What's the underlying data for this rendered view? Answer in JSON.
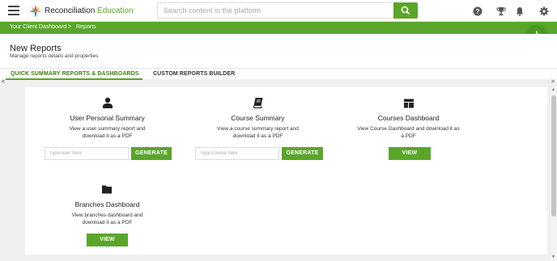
{
  "header": {
    "logo_text": "Reconciliation",
    "logo_accent": "Education",
    "search_placeholder": "Search content in the platform"
  },
  "breadcrumb": {
    "home": "Your Client Dashboard",
    "separator": ">",
    "current": "Reports"
  },
  "fab_label": "+",
  "page": {
    "title": "New Reports",
    "subtitle": "Manage reports details and properties"
  },
  "tabs": [
    {
      "label": "QUICK SUMMARY REPORTS & DASHBOARDS",
      "active": true
    },
    {
      "label": "CUSTOM REPORTS BUILDER",
      "active": false
    }
  ],
  "scroll": {
    "left": "<",
    "right": ">"
  },
  "cards": [
    {
      "title": "User Personal Summary",
      "description": "View a user summary report and download it as a PDF",
      "input_placeholder": "Type user here",
      "button": "GENERATE"
    },
    {
      "title": "Course Summary",
      "description": "View a course summary report and download it as a PDF",
      "input_placeholder": "Type course here",
      "button": "GENERATE"
    },
    {
      "title": "Courses Dashboard",
      "description": "View Course Dashboard and download it as a PDF",
      "button": "VIEW"
    },
    {
      "title": "Branches Dashboard",
      "description": "View branches dashboard and download it as a PDF",
      "button": "VIEW"
    }
  ],
  "colors": {
    "brand_green": "#5aa62b",
    "fab_green": "#4a9a22"
  },
  "icons": {
    "top_right": [
      "help-icon",
      "trophy-icon",
      "bell-icon",
      "settings-icon"
    ],
    "cards": [
      "user-icon",
      "book-icon",
      "dashboard-icon",
      "folder-icon"
    ]
  }
}
